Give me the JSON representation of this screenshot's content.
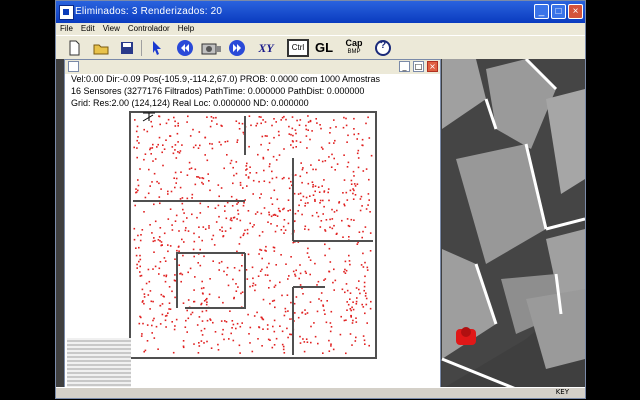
{
  "window": {
    "title": "Eliminados: 3  Renderizados: 20",
    "minimize": "_",
    "maximize": "□",
    "close": "×"
  },
  "menu": [
    "File",
    "Edit",
    "View",
    "Controlador",
    "Help"
  ],
  "toolbar": {
    "xy_label": "XY",
    "ctrl_label": "Ctrl",
    "gl_label": "GL",
    "cap_label": "Cap",
    "cap_sub": "BMP",
    "help_label": "?"
  },
  "child_window": {
    "minimize": "_",
    "maximize": "□",
    "close": "×"
  },
  "info": {
    "line1": "Vel:0.00 Dir:-0.09 Pos(-105.9,-114.2,67.0) PROB: 0.0000 com 1000 Amostras",
    "line2": "16 Sensores (3277176 Filtrados) PathTime: 0.000000 PathDist: 0.000000",
    "line3": "Grid: Res:2.00 (124,124)   Real Loc: 0.000000   ND: 0.000000"
  },
  "colors": {
    "particle": "#e02020",
    "wall": "#505050",
    "robot": "#e01818",
    "floor": "#3f3f3f",
    "wall3d": "#9c9c9c"
  },
  "status": {
    "key": "KEY"
  }
}
